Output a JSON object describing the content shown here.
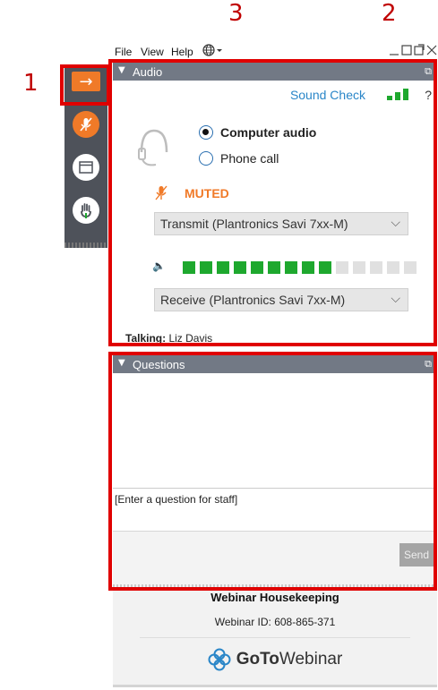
{
  "annotations": {
    "n1": "1",
    "n2": "2",
    "n3": "3"
  },
  "menu": {
    "file": "File",
    "view": "View",
    "help": "Help"
  },
  "audio": {
    "title": "Audio",
    "sound_check": "Sound Check",
    "help": "?",
    "computer_audio": "Computer audio",
    "phone_call": "Phone call",
    "selected_mode": "Computer audio",
    "muted": "MUTED",
    "transmit": "Transmit (Plantronics Savi 7xx-M)",
    "receive": "Receive (Plantronics Savi 7xx-M)",
    "level_active": 9,
    "level_total": 14,
    "talking_label": "Talking:",
    "talking_name": "Liz Davis"
  },
  "questions": {
    "title": "Questions",
    "placeholder": "[Enter a question for staff]",
    "send": "Send"
  },
  "footer": {
    "title": "Webinar Housekeeping",
    "webinar_id": "Webinar ID: 608-865-371",
    "logo_bold": "GoTo",
    "logo_rest": "Webinar"
  },
  "colors": {
    "accent": "#f07a28",
    "link": "#2a86c8",
    "level_on": "#1ea82e",
    "level_off": "#e0e0e0",
    "annotation": "#e00000"
  },
  "icons": [
    "arrow-right-icon",
    "mic-muted-icon",
    "window-icon",
    "raise-hand-icon",
    "globe-icon",
    "headset-icon",
    "speaker-icon",
    "popout-icon"
  ]
}
